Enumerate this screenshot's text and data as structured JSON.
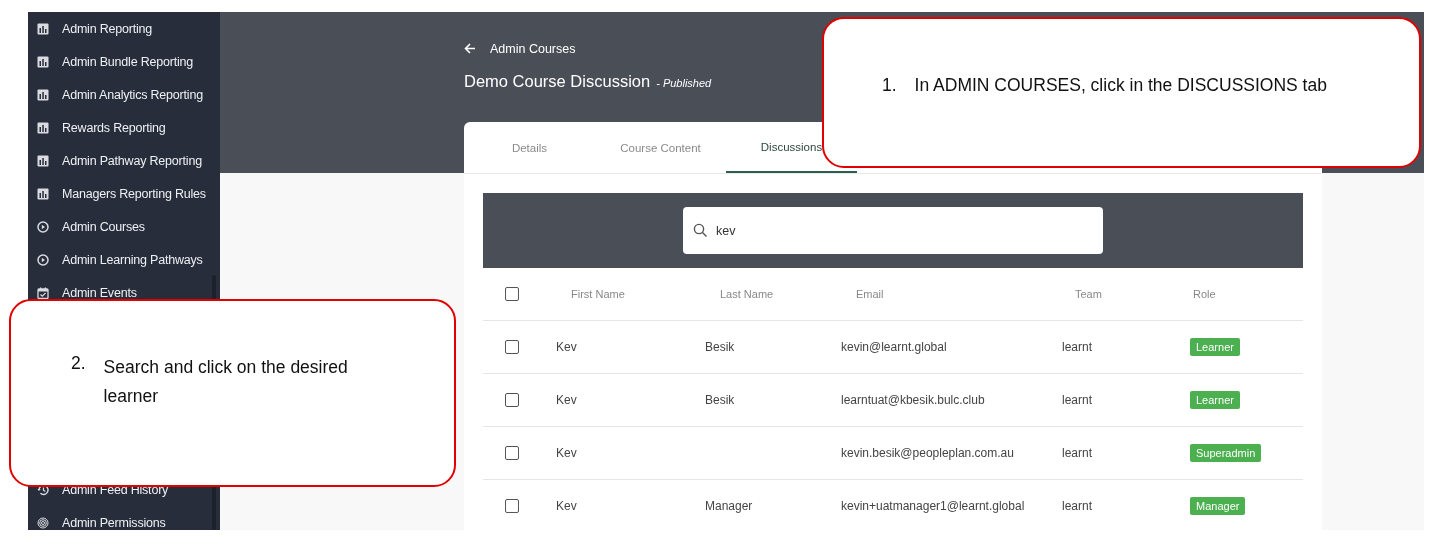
{
  "sidebar": {
    "items": [
      {
        "label": "Admin Reporting",
        "kind": "report"
      },
      {
        "label": "Admin Bundle Reporting",
        "kind": "report"
      },
      {
        "label": "Admin Analytics Reporting",
        "kind": "report"
      },
      {
        "label": "Rewards Reporting",
        "kind": "report"
      },
      {
        "label": "Admin Pathway Reporting",
        "kind": "report"
      },
      {
        "label": "Managers Reporting Rules",
        "kind": "report"
      },
      {
        "label": "Admin Courses",
        "kind": "play"
      },
      {
        "label": "Admin Learning Pathways",
        "kind": "play"
      },
      {
        "label": "Admin Events",
        "kind": "calendar"
      }
    ],
    "lower_items": [
      {
        "label": "Admin Feed History",
        "kind": "history"
      },
      {
        "label": "Admin Permissions",
        "kind": "fingerprint"
      }
    ]
  },
  "header": {
    "back_link": "Admin Courses",
    "title": "Demo Course Discussion",
    "status": "- Published"
  },
  "tabs": [
    {
      "label": "Details",
      "selected": false
    },
    {
      "label": "Course Content",
      "selected": false
    },
    {
      "label": "Discussions",
      "selected": true
    }
  ],
  "search": {
    "value": "kev"
  },
  "table": {
    "select_all_checked": false,
    "columns": [
      "First Name",
      "Last Name",
      "Email",
      "Team",
      "Role"
    ],
    "rows": [
      {
        "checked": false,
        "first_name": "Kev",
        "last_name": "Besik",
        "email": "kevin@learnt.global",
        "team": "learnt",
        "role": "Learner"
      },
      {
        "checked": false,
        "first_name": "Kev",
        "last_name": "Besik",
        "email": "learntuat@kbesik.bulc.club",
        "team": "learnt",
        "role": "Learner"
      },
      {
        "checked": false,
        "first_name": "Kev",
        "email": "kevin.besik@peopleplan.com.au",
        "team": "learnt",
        "role": "Superadmin"
      },
      {
        "checked": false,
        "first_name": "Kev",
        "last_name": "Manager",
        "email": "kevin+uatmanager1@learnt.global",
        "team": "learnt",
        "role": "Manager"
      }
    ]
  },
  "callouts": [
    {
      "number": "1.",
      "text": "In ADMIN COURSES, click in the DISCUSSIONS tab"
    },
    {
      "number": "2.",
      "text": "Search and click on the desired learner"
    }
  ]
}
